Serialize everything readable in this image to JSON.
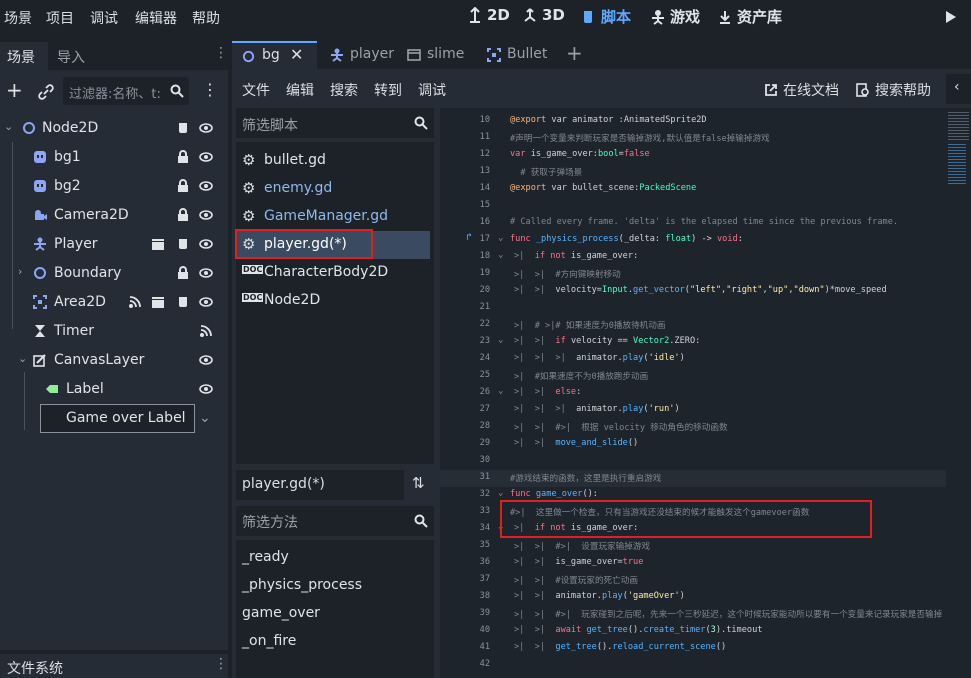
{
  "menu": [
    "场景",
    "项目",
    "调试",
    "编辑器",
    "帮助"
  ],
  "workspaces": [
    {
      "label": "2D",
      "icon": "2d-icon"
    },
    {
      "label": "3D",
      "icon": "3d-icon"
    },
    {
      "label": "脚本",
      "icon": "script-icon",
      "active": true
    },
    {
      "label": "游戏",
      "icon": "game-icon"
    },
    {
      "label": "资产库",
      "icon": "assetlib-icon"
    }
  ],
  "scene_dock": {
    "tabs": [
      "场景",
      "导入"
    ],
    "filter_placeholder": "过滤器:名称、t:",
    "nodes": [
      "Node2D",
      "bg1",
      "bg2",
      "Camera2D",
      "Player",
      "Boundary",
      "Area2D",
      "Timer",
      "CanvasLayer",
      "Label",
      "Game over Label"
    ]
  },
  "filesystem_label": "文件系统",
  "editor_tabs": [
    "bg",
    "player",
    "slime",
    "Bullet"
  ],
  "script_menu": [
    "文件",
    "编辑",
    "搜索",
    "转到",
    "调试"
  ],
  "online_docs": "在线文档",
  "search_help": "搜索帮助",
  "script_filter": "筛选脚本",
  "scripts": [
    "bullet.gd",
    "enemy.gd",
    "GameManager.gd",
    "player.gd(*)",
    "CharacterBody2D",
    "Node2D"
  ],
  "current_script": "player.gd(*)",
  "method_filter": "筛选方法",
  "methods": [
    "_ready",
    "_physics_process",
    "game_over",
    "_on_fire"
  ],
  "accent_color": "#5fa8ff",
  "highlight_color": "#e02020",
  "code": {
    "line_numbers": [
      "10",
      "11",
      "12",
      "13",
      "14",
      "15",
      "16",
      "17",
      "18",
      "19",
      "20",
      "21",
      "22",
      "23",
      "24",
      "25",
      "26",
      "27",
      "28",
      "29",
      "30",
      "31",
      "32",
      "33",
      "34",
      "35",
      "36",
      "37",
      "38",
      "39",
      "40",
      "41",
      "42"
    ],
    "l10a": "@export",
    "l10b": " var animator :AnimatedSprite2D",
    "l11": "#声明一个变量来判断玩家是否输掉游戏,默认值是false掉输掉游戏",
    "l12a": "var",
    "l12b": " is_game_over:",
    "l12c": "bool",
    "l12d": "=",
    "l12e": "false",
    "l13": "# 获取子弹场景",
    "l14a": "@export",
    "l14b": " var bullet_scene:",
    "l14c": "PackedScene",
    "l16": "# Called every frame. 'delta' is the elapsed time since the previous frame.",
    "l17a": "func",
    "l17b": " _physics_process",
    "l17c": "(_delta: ",
    "l17d": "float",
    "l17e": ") -> ",
    "l17f": "void",
    "l17g": ":",
    "l18a": "if not",
    "l18b": " is_game_over:",
    "l19": "#方向键映射移动",
    "l20a": "velocity=",
    "l20b": "Input",
    "l20c": ".",
    "l20d": "get_vector",
    "l20e": "(",
    "l20f": "\"left\"",
    "l20g": ",",
    "l20h": "\"right\"",
    "l20i": ",",
    "l20j": "\"up\"",
    "l20k": ",",
    "l20l": "\"down\"",
    "l20m": ")*move_speed",
    "l22": "# 如果速度为0播放待机动画",
    "l23a": "if",
    "l23b": " velocity == ",
    "l23c": "Vector2",
    "l23d": ".ZERO:",
    "l24a": "animator.",
    "l24b": "play",
    "l24c": "(",
    "l24d": "'idle'",
    "l24e": ")",
    "l25": "#如果速度不为0播放跑步动画",
    "l26": "else",
    "l26b": ":",
    "l27a": "animator.",
    "l27b": "play",
    "l27c": "(",
    "l27d": "'run'",
    "l27e": ")",
    "l28": "根据 velocity 移动角色的移动函数",
    "l29": "move_and_slide",
    "l29b": "()",
    "l31": "#游戏结束的函数，这里是执行重启游戏",
    "l32a": "func",
    "l32b": " game_over",
    "l32c": "():",
    "l33": "这里做一个检查，只有当游戏还没结束的候才能触发这个gamevoer函数",
    "l34a": "if not",
    "l34b": " is_game_over:",
    "l35": "设置玩家输掉游戏",
    "l36a": "is_game_over=",
    "l36b": "true",
    "l37": "#设置玩家的死亡动画",
    "l38a": "animator.",
    "l38b": "play",
    "l38c": "(",
    "l38d": "'gameOver'",
    "l38e": ")",
    "l39": "玩家碰到之后呢，先来一个三秒延迟，这个时候玩家能动所以要有一个变量来记录玩家是否输掉",
    "l40a": "await",
    "l40b": " get_tree",
    "l40c": "().",
    "l40d": "create_timer",
    "l40e": "(",
    "l40f": "3",
    "l40g": ").timeout",
    "l41a": "get_tree",
    "l41b": "().",
    "l41c": "reload_current_scene",
    "l41d": "()"
  }
}
